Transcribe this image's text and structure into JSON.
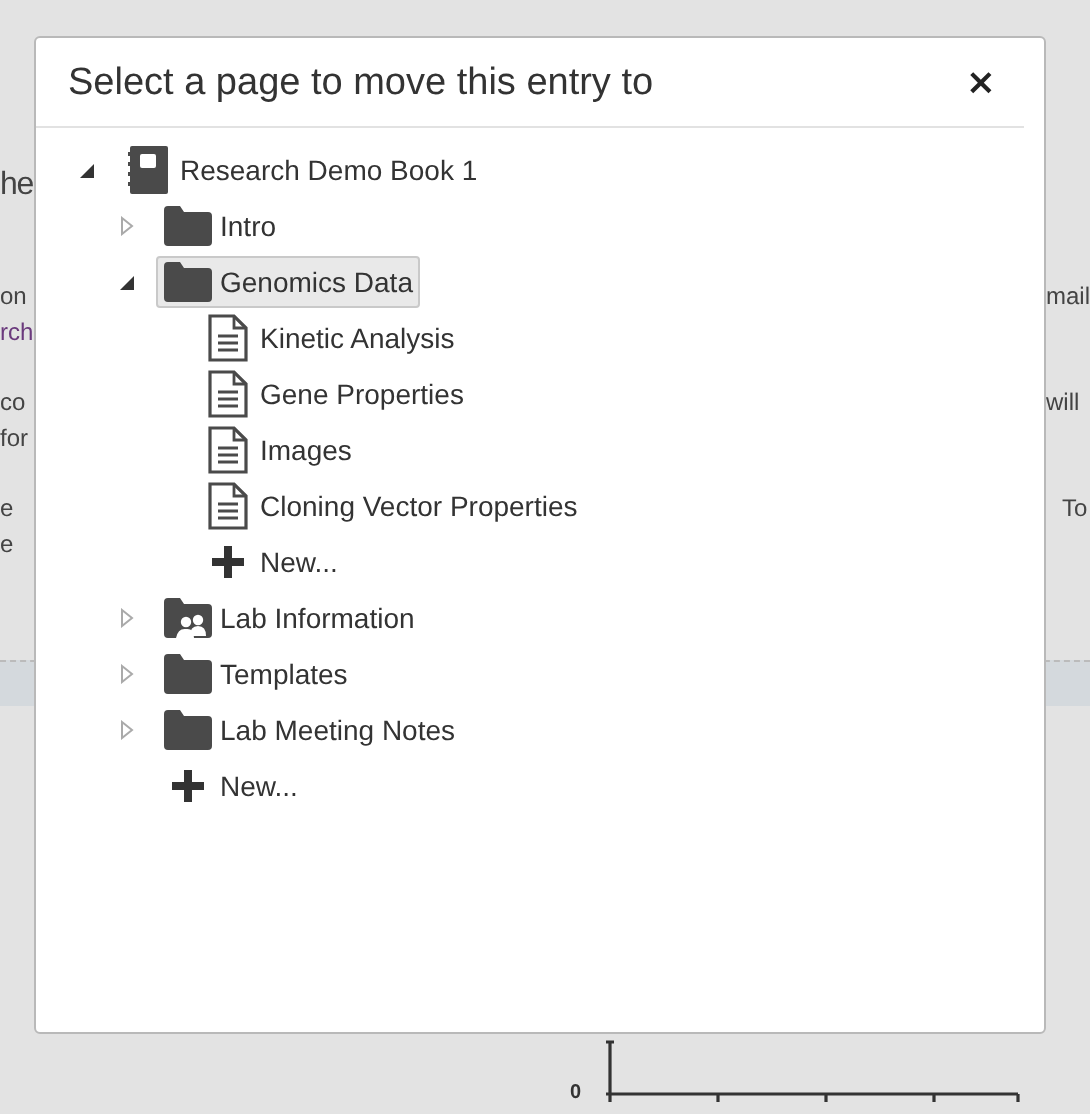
{
  "background": {
    "heading": "he",
    "rows": [
      {
        "left": [
          {
            "text": "on",
            "kind": "text"
          },
          {
            "text": "rch",
            "kind": "link"
          }
        ],
        "right": [
          "mail"
        ]
      },
      {
        "left": [
          {
            "text": "co",
            "kind": "text"
          },
          {
            "text": "for",
            "kind": "text"
          }
        ],
        "right": [
          "will"
        ]
      },
      {
        "left": [
          {
            "text": "e",
            "kind": "text"
          },
          {
            "text": "e",
            "kind": "text"
          }
        ],
        "right": [
          "To"
        ]
      }
    ],
    "chart_axis_label": "0"
  },
  "dialog": {
    "title": "Select a page to move this entry to",
    "close": "×"
  },
  "tree": [
    {
      "kind": "notebook",
      "label": "Research Demo Book 1",
      "selected": false,
      "expanded": true,
      "children": [
        {
          "kind": "folder",
          "label": "Intro",
          "selected": false,
          "expanded": false
        },
        {
          "kind": "folder",
          "label": "Genomics Data",
          "selected": true,
          "expanded": true,
          "children": [
            {
              "kind": "page",
              "label": "Kinetic Analysis",
              "selected": false
            },
            {
              "kind": "page",
              "label": "Gene Properties",
              "selected": false
            },
            {
              "kind": "page",
              "label": "Images",
              "selected": false
            },
            {
              "kind": "page",
              "label": "Cloning Vector Properties",
              "selected": false
            },
            {
              "kind": "new",
              "label": "New...",
              "selected": false
            }
          ]
        },
        {
          "kind": "shared-folder",
          "label": "Lab Information",
          "selected": false,
          "expanded": false
        },
        {
          "kind": "folder",
          "label": "Templates",
          "selected": false,
          "expanded": false
        },
        {
          "kind": "folder",
          "label": "Lab Meeting Notes",
          "selected": false,
          "expanded": false
        },
        {
          "kind": "new",
          "label": "New...",
          "selected": false
        }
      ]
    }
  ]
}
